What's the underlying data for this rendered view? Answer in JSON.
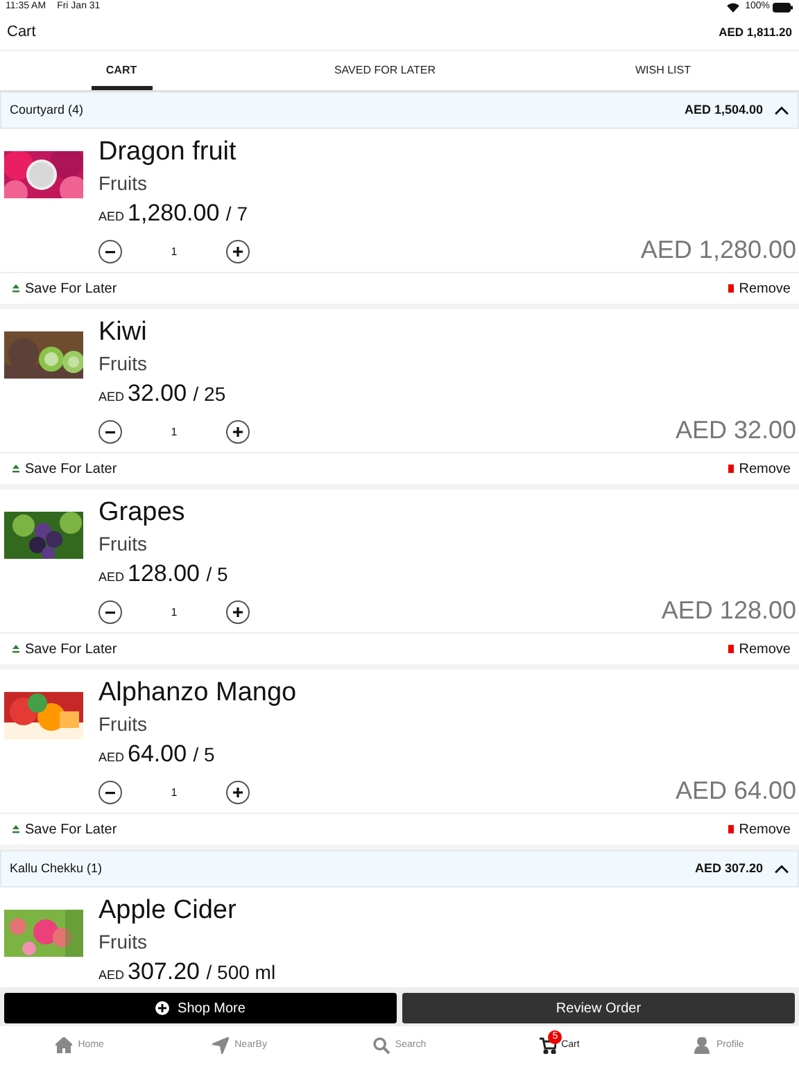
{
  "status_bar": {
    "time": "11:35 AM",
    "date": "Fri Jan 31",
    "battery": "100%"
  },
  "header": {
    "title": "Cart",
    "total": "AED 1,811.20"
  },
  "tabs": [
    {
      "label": "CART",
      "selected": true
    },
    {
      "label": "SAVED FOR LATER",
      "selected": false
    },
    {
      "label": "WISH LIST",
      "selected": false
    }
  ],
  "groups": [
    {
      "name": "Courtyard (4)",
      "total": "AED 1,504.00",
      "expanded": true,
      "items": [
        {
          "name": "Dragon fruit",
          "category": "Fruits",
          "currency": "AED",
          "price": "1,280.00",
          "unit": "/ 7",
          "quantity": "1",
          "line_total": "AED 1,280.00",
          "save": "Save For Later",
          "remove": "Remove"
        },
        {
          "name": "Kiwi",
          "category": "Fruits",
          "currency": "AED",
          "price": "32.00",
          "unit": "/ 25",
          "quantity": "1",
          "line_total": "AED 32.00",
          "save": "Save For Later",
          "remove": "Remove"
        },
        {
          "name": "Grapes",
          "category": "Fruits",
          "currency": "AED",
          "price": "128.00",
          "unit": "/ 5",
          "quantity": "1",
          "line_total": "AED 128.00",
          "save": "Save For Later",
          "remove": "Remove"
        },
        {
          "name": "Alphanzo Mango",
          "category": "Fruits",
          "currency": "AED",
          "price": "64.00",
          "unit": "/ 5",
          "quantity": "1",
          "line_total": "AED 64.00",
          "save": "Save For Later",
          "remove": "Remove"
        }
      ]
    },
    {
      "name": "Kallu Chekku (1)",
      "total": "AED 307.20",
      "expanded": true,
      "items": [
        {
          "name": "Apple Cider",
          "category": "Fruits",
          "currency": "AED",
          "price": "307.20",
          "unit": "/ 500 ml"
        }
      ]
    }
  ],
  "actions": {
    "shop_more": "Shop More",
    "review": "Review Order"
  },
  "nav": [
    {
      "label": "Home",
      "selected": false
    },
    {
      "label": "NearBy",
      "selected": false
    },
    {
      "label": "Search",
      "selected": false
    },
    {
      "label": "Cart",
      "selected": true,
      "badge": "5"
    },
    {
      "label": "Profile",
      "selected": false
    }
  ]
}
